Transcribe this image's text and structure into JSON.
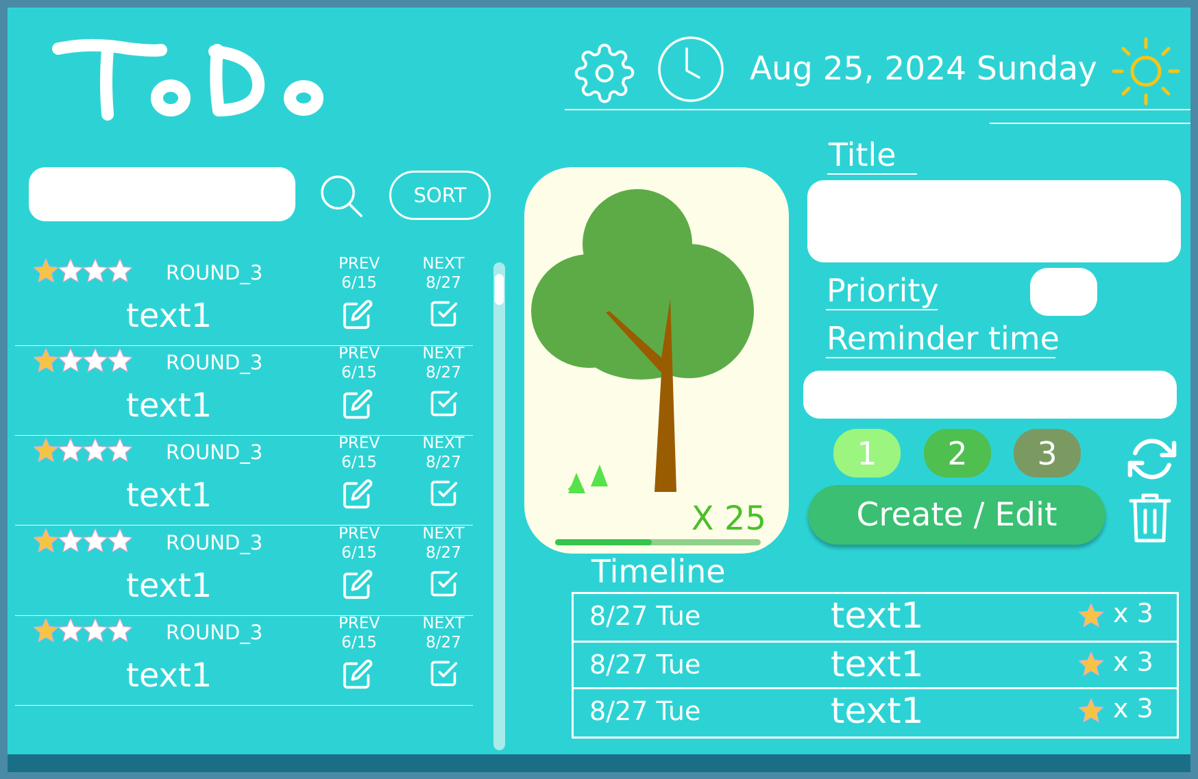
{
  "header": {
    "logo_text": "ToDo",
    "date_text": "Aug 25, 2024 Sunday"
  },
  "search": {
    "value": "",
    "placeholder": "",
    "sort_label": "SORT"
  },
  "list": {
    "items": [
      {
        "stars_filled": 1,
        "stars_total": 4,
        "round": "ROUND_3",
        "prev_label": "PREV",
        "prev_date": "6/15",
        "next_label": "NEXT",
        "next_date": "8/27",
        "text": "text1"
      },
      {
        "stars_filled": 1,
        "stars_total": 4,
        "round": "ROUND_3",
        "prev_label": "PREV",
        "prev_date": "6/15",
        "next_label": "NEXT",
        "next_date": "8/27",
        "text": "text1"
      },
      {
        "stars_filled": 1,
        "stars_total": 4,
        "round": "ROUND_3",
        "prev_label": "PREV",
        "prev_date": "6/15",
        "next_label": "NEXT",
        "next_date": "8/27",
        "text": "text1"
      },
      {
        "stars_filled": 1,
        "stars_total": 4,
        "round": "ROUND_3",
        "prev_label": "PREV",
        "prev_date": "6/15",
        "next_label": "NEXT",
        "next_date": "8/27",
        "text": "text1"
      },
      {
        "stars_filled": 1,
        "stars_total": 4,
        "round": "ROUND_3",
        "prev_label": "PREV",
        "prev_date": "6/15",
        "next_label": "NEXT",
        "next_date": "8/27",
        "text": "text1"
      }
    ]
  },
  "tree": {
    "count_text": "X 25",
    "progress_fraction": 0.47
  },
  "form": {
    "title_label": "Title",
    "title_value": "",
    "priority_label": "Priority",
    "priority_value": "",
    "reminder_label": "Reminder time",
    "reminder_value": "",
    "priority_options": [
      {
        "label": "1",
        "color": "#9bf57e"
      },
      {
        "label": "2",
        "color": "#4fbf4f"
      },
      {
        "label": "3",
        "color": "#7a9a62"
      }
    ],
    "create_label": "Create / Edit"
  },
  "timeline": {
    "label": "Timeline",
    "rows": [
      {
        "date": "8/27 Tue",
        "text": "text1",
        "count": "x 3"
      },
      {
        "date": "8/27 Tue",
        "text": "text1",
        "count": "x 3"
      },
      {
        "date": "8/27 Tue",
        "text": "text1",
        "count": "x 3"
      }
    ]
  },
  "icons": {
    "settings": "gear-icon",
    "clock": "clock-icon",
    "weather": "sun-icon",
    "search": "search-icon",
    "edit": "edit-icon",
    "complete": "checkbox-icon",
    "reset": "refresh-icon",
    "delete": "trash-icon",
    "rating": "star-icon"
  },
  "colors": {
    "background": "#2dd3d4",
    "frame": "#4a8aa6",
    "bottom_bar": "#1a6f86",
    "create_button": "#3abf73",
    "sun": "#f5c518",
    "tree_card": "#fdfde8",
    "star_gold": "#f6c443"
  }
}
